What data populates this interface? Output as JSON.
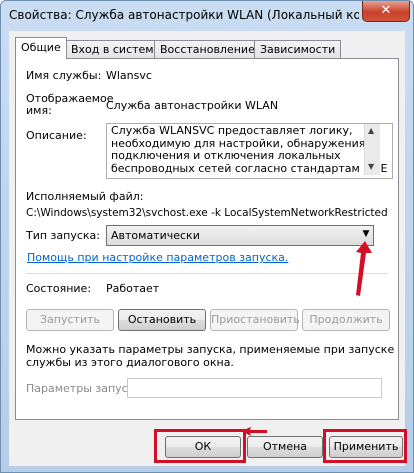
{
  "window": {
    "title": "Свойства: Служба автонастройки WLAN (Локальный компьют...",
    "close_glyph": "✕"
  },
  "tabs": [
    "Общие",
    "Вход в систему",
    "Восстановление",
    "Зависимости"
  ],
  "general": {
    "service_name_label": "Имя службы:",
    "service_name_value": "Wlansvc",
    "display_name_label": "Отображаемое имя:",
    "display_name_value": "Служба автонастройки WLAN",
    "description_label": "Описание:",
    "description_lines": [
      "Служба WLANSVC предоставляет логику,",
      "необходимую для настройки, обнаружения,",
      "подключения и отключения локальных",
      "беспроводных сетей согласно стандартам IEEE"
    ],
    "exe_label": "Исполняемый файл:",
    "exe_value": "C:\\Windows\\system32\\svchost.exe -k LocalSystemNetworkRestricted",
    "startup_type_label": "Тип запуска:",
    "startup_type_value": "Автоматически",
    "help_link": "Помощь при настройке параметров запуска.",
    "state_label": "Состояние:",
    "state_value": "Работает",
    "buttons": {
      "start": "Запустить",
      "stop": "Остановить",
      "pause": "Приостановить",
      "resume": "Продолжить"
    },
    "note_lines": [
      "Можно указать параметры запуска, применяемые при запуске",
      "службы из этого диалогового окна."
    ],
    "params_label": "Параметры запуска:",
    "params_value": ""
  },
  "footer": {
    "ok": "ОК",
    "cancel": "Отмена",
    "apply": "Применить"
  },
  "colors": {
    "highlight": "#d20f25",
    "link": "#0066cc"
  }
}
